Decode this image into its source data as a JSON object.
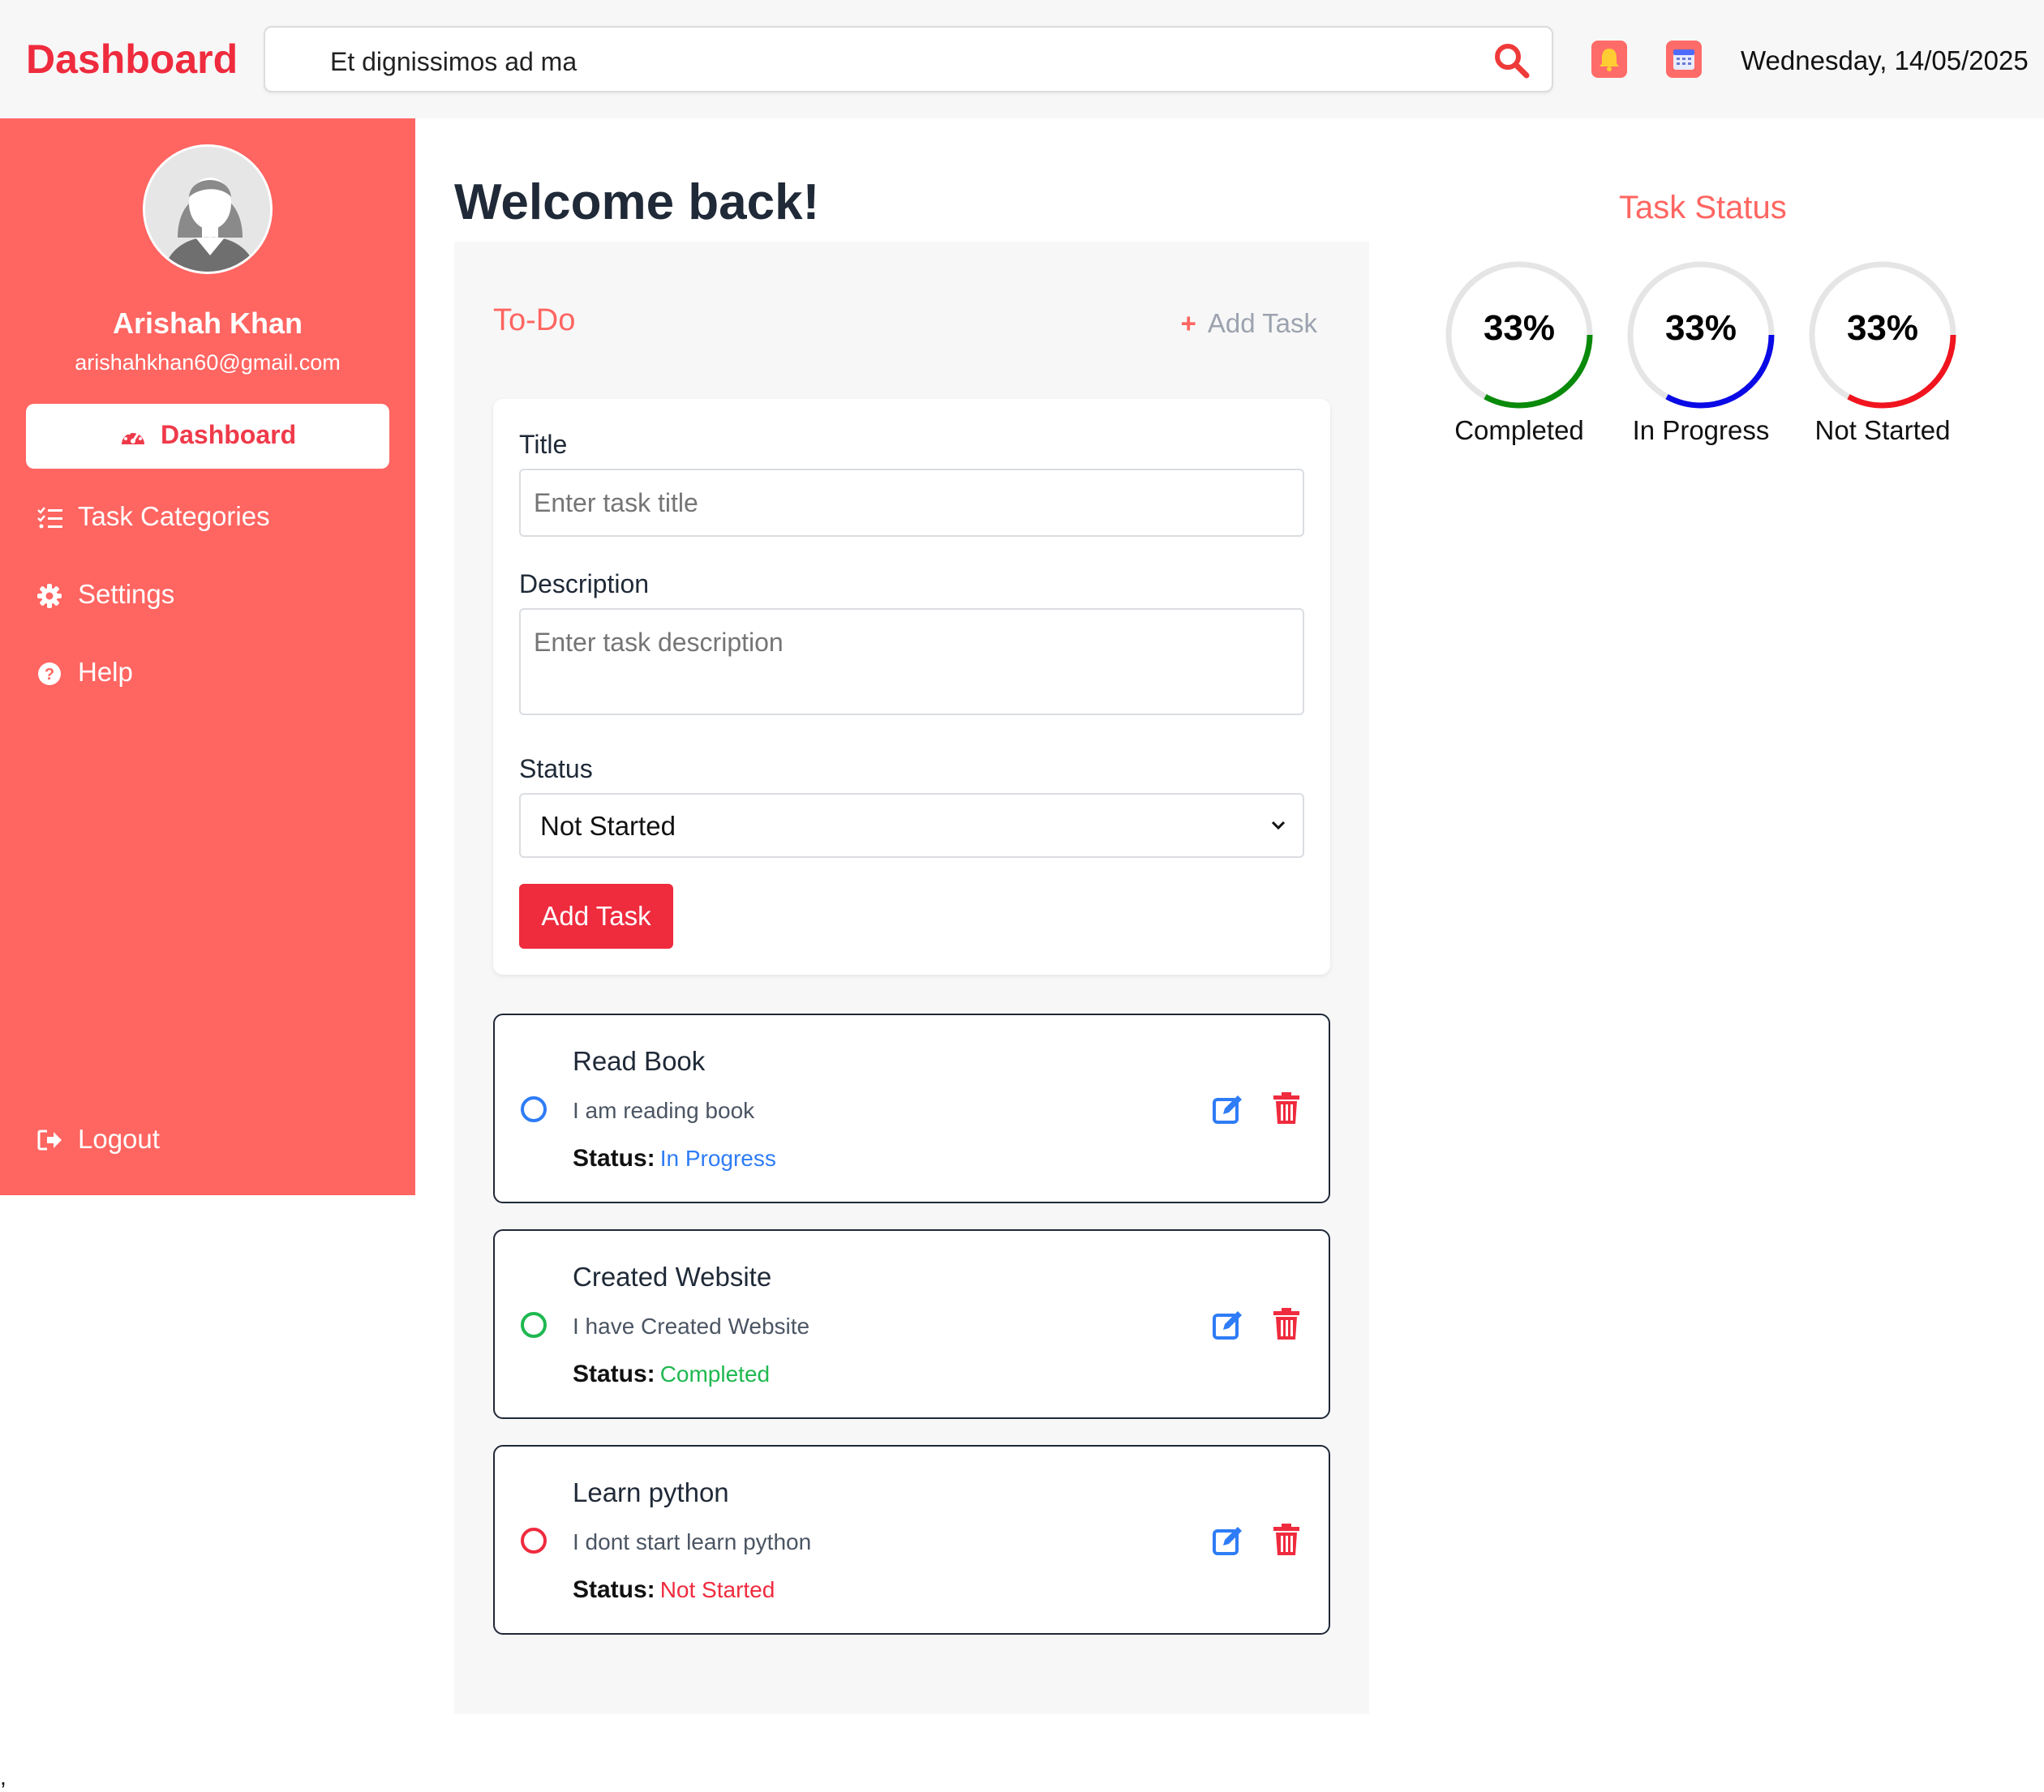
{
  "header": {
    "brand": "Dashboard",
    "search_value": "Et dignissimos ad ma",
    "date": "Wednesday, 14/05/2025"
  },
  "sidebar": {
    "user_name": "Arishah Khan",
    "user_email": "arishahkhan60@gmail.com",
    "items": [
      {
        "label": "Dashboard",
        "icon": "gauge-icon"
      },
      {
        "label": "Task Categories",
        "icon": "list-check-icon"
      },
      {
        "label": "Settings",
        "icon": "gear-icon"
      },
      {
        "label": "Help",
        "icon": "question-circle-icon"
      }
    ],
    "logout": "Logout"
  },
  "main": {
    "welcome": "Welcome back!",
    "todo": {
      "title": "To-Do",
      "add_link": "Add Task",
      "add_link_icon": "+",
      "form": {
        "title_label": "Title",
        "title_placeholder": "Enter task title",
        "description_label": "Description",
        "description_placeholder": "Enter task description",
        "status_label": "Status",
        "status_value": "Not Started",
        "submit_label": "Add Task"
      },
      "status_prefix": "Status:",
      "tasks": [
        {
          "title": "Read Book",
          "description": "I am reading book",
          "status": "In Progress",
          "color": "#2e7cf6"
        },
        {
          "title": "Created Website",
          "description": "I have Created Website",
          "status": "Completed",
          "color": "#1fb850"
        },
        {
          "title": "Learn python",
          "description": "I dont start learn python",
          "status": "Not Started",
          "color": "#ef2b3e"
        }
      ]
    }
  },
  "task_status": {
    "title": "Task Status",
    "gauges": [
      {
        "label": "Completed",
        "percent": "33%",
        "value": 33,
        "color": "#0a8a0a"
      },
      {
        "label": "In Progress",
        "percent": "33%",
        "value": 33,
        "color": "#0a0ae6"
      },
      {
        "label": "Not Started",
        "percent": "33%",
        "value": 33,
        "color": "#f0141e"
      }
    ]
  },
  "stray_mark": ","
}
